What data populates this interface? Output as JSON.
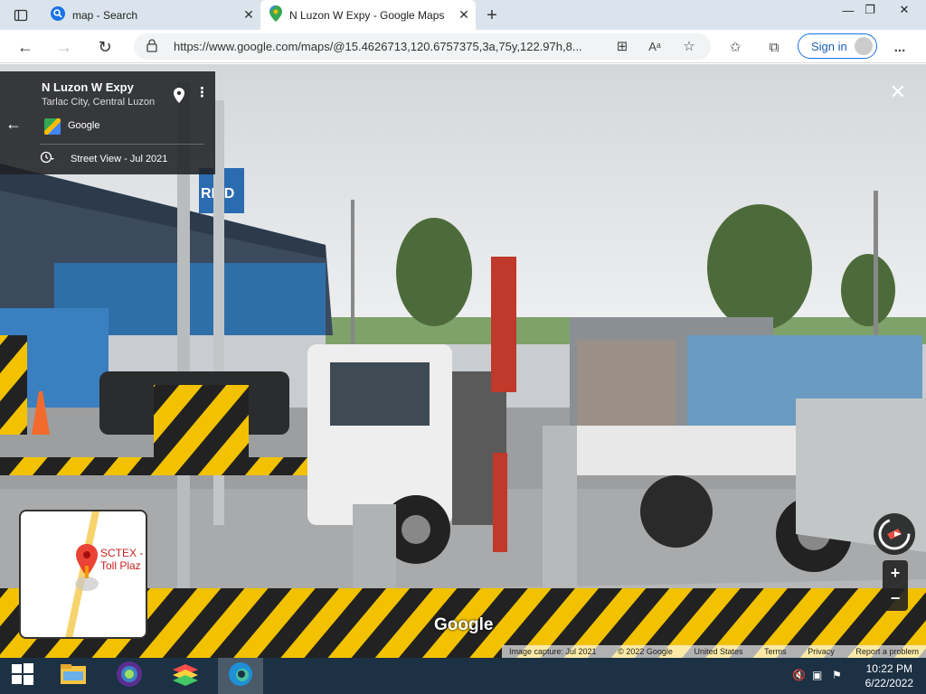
{
  "browser": {
    "tabs": [
      {
        "title": "map - Search",
        "active": false,
        "icon": "search-icon"
      },
      {
        "title": "N Luzon W Expy - Google Maps",
        "active": true,
        "icon": "maps-pin-icon"
      }
    ],
    "new_tab": "+",
    "url": "https://www.google.com/maps/@15.4626713,120.6757375,3a,75y,122.97h,8...",
    "sign_in": "Sign in",
    "more": "..."
  },
  "streetview": {
    "place_name": "N Luzon W Expy",
    "place_sub": "Tarlac City, Central Luzon",
    "provider": "Google",
    "capture_label": "Street View - Jul 2021",
    "minimap_label_line1": "SCTEX -",
    "minimap_label_line2": "Toll Plaz",
    "zoom_in": "+",
    "zoom_out": "−",
    "watermark": "Google",
    "scene_sign": "RFID",
    "footer": [
      "Image capture: Jul 2021",
      "© 2022 Google",
      "United States",
      "Terms",
      "Privacy",
      "Report a problem"
    ]
  },
  "taskbar": {
    "time": "10:22 PM",
    "date": "6/22/2022"
  },
  "colors": {
    "accent": "#1a73e8",
    "tabbar_bg": "#dbe4ec",
    "taskbar_bg": "#1d3144",
    "barrier_yellow": "#f2c200",
    "map_pin_red": "#ea4335"
  }
}
